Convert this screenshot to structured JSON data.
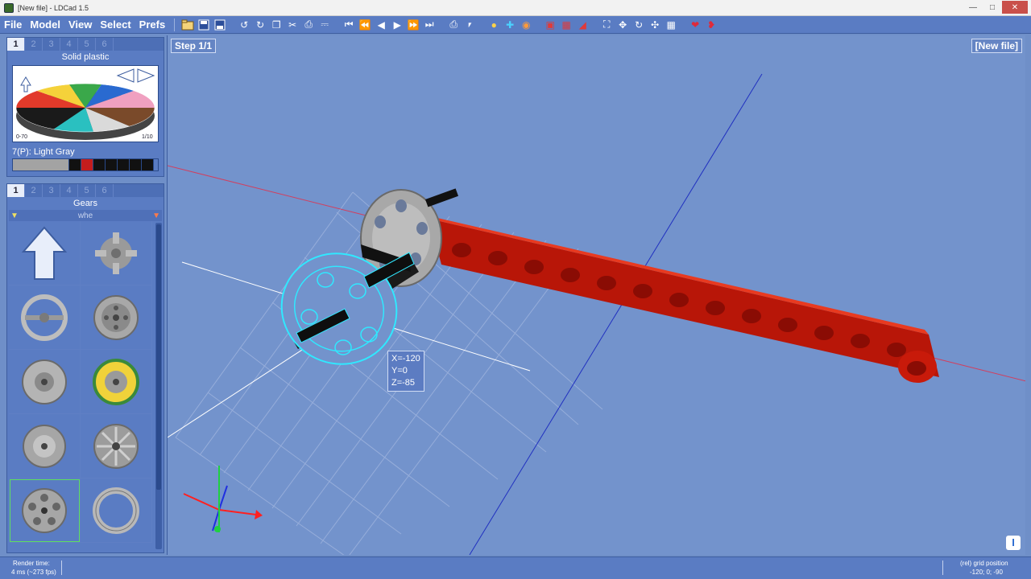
{
  "window": {
    "title": "[New file] - LDCad 1.5"
  },
  "menu": {
    "items": [
      "File",
      "Model",
      "View",
      "Select",
      "Prefs"
    ]
  },
  "color_panel": {
    "tabs": [
      "1",
      "2",
      "3",
      "4",
      "5",
      "6"
    ],
    "title": "Solid plastic",
    "range_left": "0-70",
    "range_right": "1/10",
    "current_color": "7(P): Light Gray",
    "swatches": [
      "#a3a3a3",
      "#a3a3a3",
      "#a3a3a3",
      "#a3a3a3",
      "#a3a3a3",
      "#a3a3a3",
      "#111111",
      "#c41d1d",
      "#111111",
      "#111111",
      "#111111",
      "#111111",
      "#111111"
    ]
  },
  "parts_panel": {
    "tabs": [
      "1",
      "2",
      "3",
      "4",
      "5",
      "6"
    ],
    "title": "Gears",
    "filter": "whe"
  },
  "viewport": {
    "step": "Step 1/1",
    "file": "[New file]",
    "coords": {
      "x": "X=-120",
      "y": "Y=0",
      "z": "Z=-85"
    }
  },
  "status": {
    "render_label": "Render time:",
    "render_value": "4 ms (~273 fps)",
    "grid_label": "(rel) grid position",
    "grid_value": "-120; 0; -90"
  },
  "colors": {
    "accent": "#5a7cc3",
    "viewport": "#7393cc",
    "beam": "#d81e0a",
    "selection": "#30e8ff"
  }
}
